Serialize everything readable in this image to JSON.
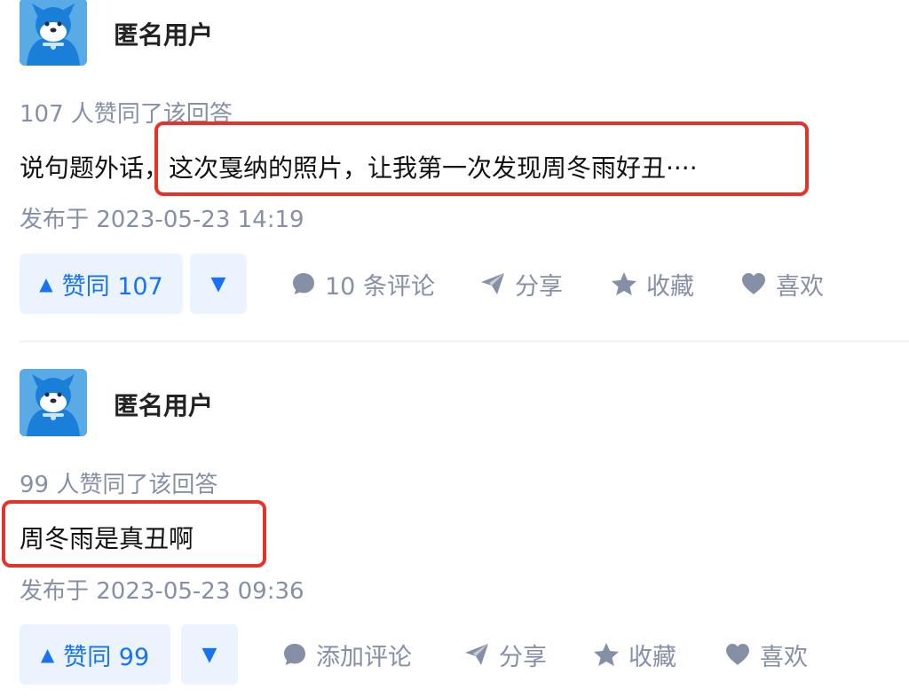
{
  "answers": [
    {
      "author": "匿名用户",
      "votes_text": "107 人赞同了该回答",
      "content": "说句题外话，这次戛纳的照片，让我第一次发现周冬雨好丑····",
      "published": "发布于 2023-05-23 14:19",
      "upvote_label": "赞同 107",
      "comment_label": "10 条评论",
      "share_label": "分享",
      "favorite_label": "收藏",
      "like_label": "喜欢"
    },
    {
      "author": "匿名用户",
      "votes_text": "99 人赞同了该回答",
      "content": "周冬雨是真丑啊",
      "published": "发布于 2023-05-23 09:36",
      "upvote_label": "赞同 99",
      "comment_label": "添加评论",
      "share_label": "分享",
      "favorite_label": "收藏",
      "like_label": "喜欢"
    }
  ],
  "icons": {
    "upvote": "▲",
    "downvote": "▼"
  },
  "colors": {
    "accent": "#1772f6",
    "vote_bg": "#ebf3fe",
    "meta_text": "#8590a6",
    "highlight_border": "#e8312b"
  }
}
